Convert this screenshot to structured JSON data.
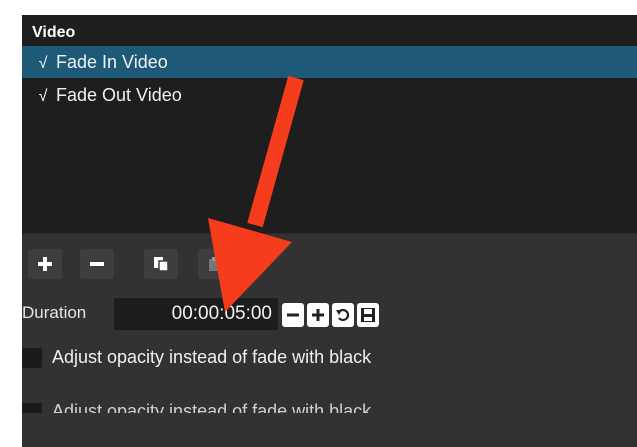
{
  "list": {
    "group_title": "Video",
    "items": [
      {
        "label": "Fade In Video",
        "checked": true,
        "selected": true
      },
      {
        "label": "Fade Out Video",
        "checked": true,
        "selected": false
      }
    ],
    "check_glyph": "√"
  },
  "toolbar": {
    "buttons": [
      {
        "name": "add-filter-button",
        "icon": "plus-icon"
      },
      {
        "name": "remove-filter-button",
        "icon": "minus-icon"
      },
      {
        "name": "copy-filter-button",
        "icon": "copy-icon"
      },
      {
        "name": "paste-filter-button",
        "icon": "paste-icon"
      }
    ]
  },
  "duration": {
    "label": "Duration",
    "value": "00:00:05:00"
  },
  "opacity_option": {
    "label": "Adjust opacity instead of fade with black",
    "checked": false
  },
  "ghost_text": "Adjust opacity instead of fade with black",
  "annotation": {
    "color": "#f53c1d",
    "icon": "red-arrow-annotation"
  },
  "colors": {
    "selection": "#1e5a78",
    "panel": "#323232",
    "list_bg": "#1e1e1e"
  }
}
